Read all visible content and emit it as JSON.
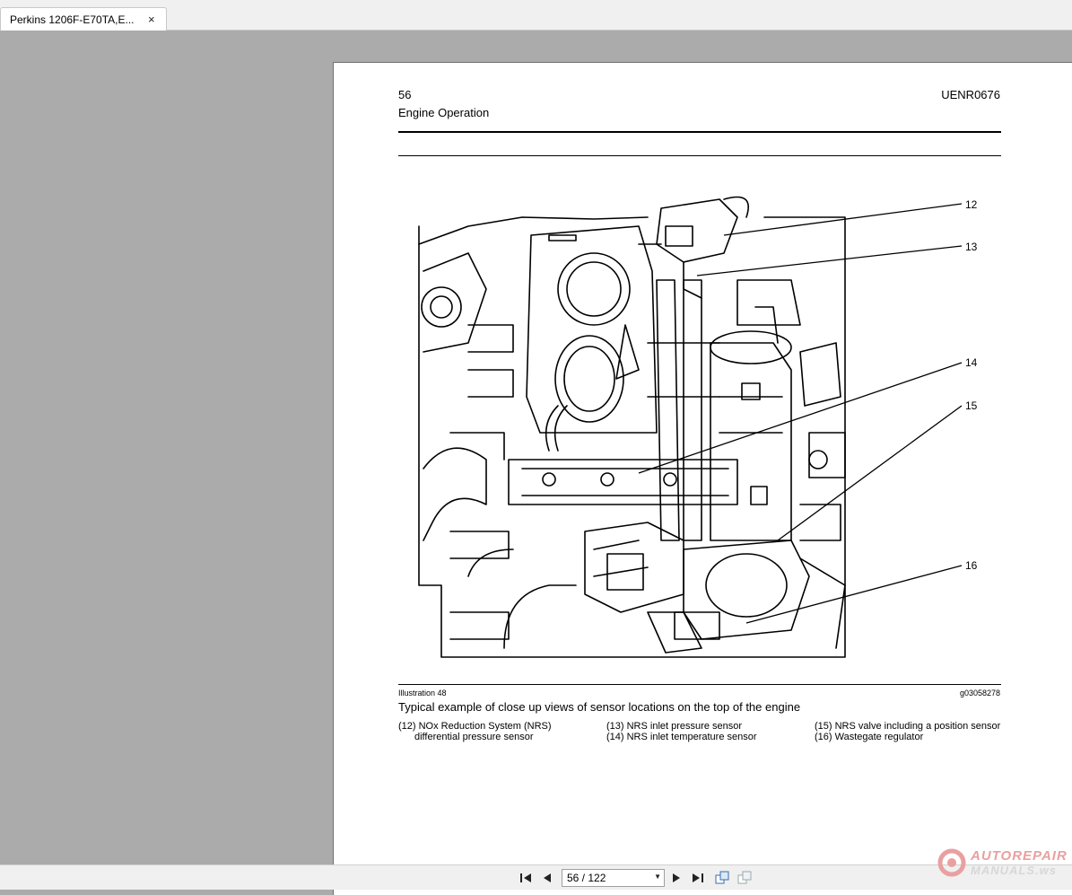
{
  "tab": {
    "title": "Perkins 1206F-E70TA,E...",
    "close_symbol": "×"
  },
  "page": {
    "number": "56",
    "doc_id": "UENR0676",
    "section": "Engine Operation",
    "illustration_label": "Illustration 48",
    "illustration_id": "g03058278",
    "caption": "Typical example of close up views of sensor locations on the top of the engine",
    "callouts": [
      "12",
      "13",
      "14",
      "15",
      "16"
    ],
    "legend": {
      "col1": [
        "(12) NOx Reduction System (NRS)",
        "differential pressure sensor"
      ],
      "col2": [
        "(13) NRS inlet pressure sensor",
        "(14) NRS inlet temperature sensor"
      ],
      "col3": [
        "(15) NRS valve including a position sensor",
        "(16) Wastegate regulator"
      ]
    }
  },
  "navigation": {
    "page_display": "56 / 122",
    "icons": [
      "first-page-icon",
      "previous-page-icon",
      "next-page-icon",
      "last-page-icon",
      "fit-page-icon",
      "fit-width-icon"
    ]
  },
  "watermark": {
    "line1": "AUTOREPAIR",
    "line2": "MANUALS.ws"
  }
}
